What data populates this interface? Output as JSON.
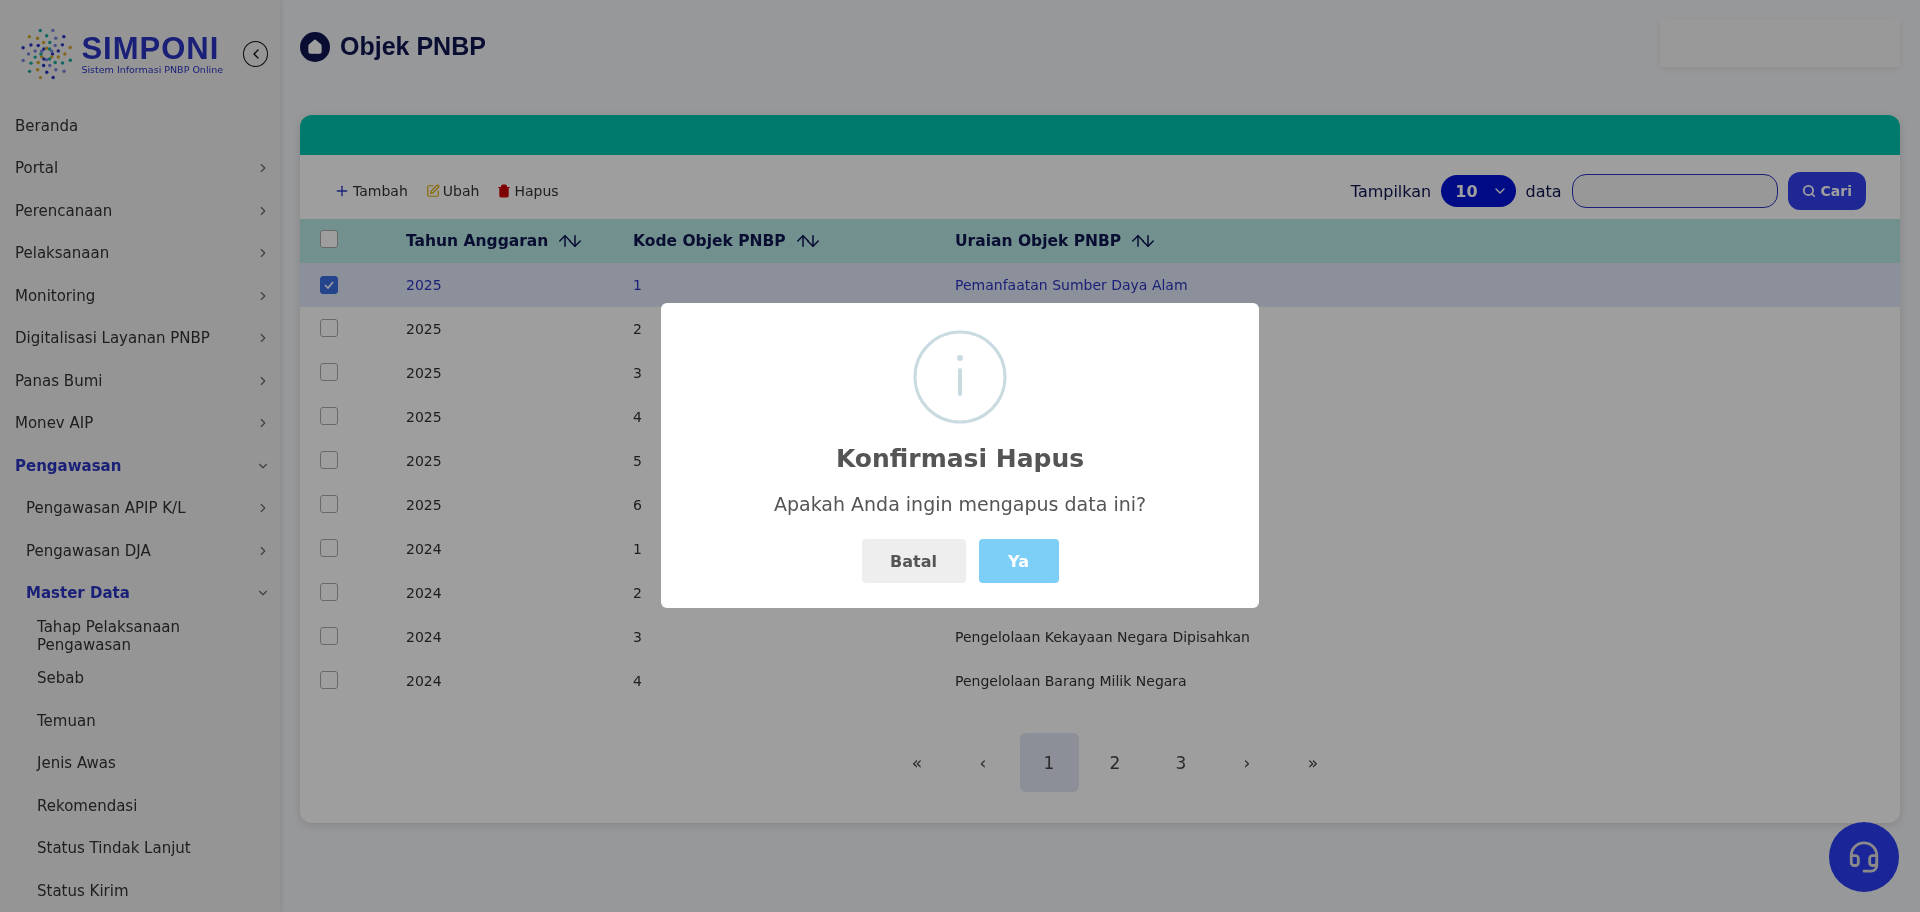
{
  "brand": {
    "name": "SIMPONI",
    "tagline": "Sistem Informasi PNBP Online"
  },
  "sidebar": {
    "items": [
      {
        "label": "Beranda",
        "active": false
      },
      {
        "label": "Portal",
        "active": false,
        "expanded": false
      },
      {
        "label": "Perencanaan",
        "active": false,
        "expanded": false
      },
      {
        "label": "Pelaksanaan",
        "active": false,
        "expanded": false
      },
      {
        "label": "Monitoring",
        "active": false,
        "expanded": false
      },
      {
        "label": "Digitalisasi Layanan PNBP",
        "active": false,
        "expanded": false
      },
      {
        "label": "Panas Bumi",
        "active": false,
        "expanded": false
      },
      {
        "label": "Monev AIP",
        "active": false,
        "expanded": false
      },
      {
        "label": "Pengawasan",
        "active": true,
        "expanded": true,
        "children": [
          {
            "label": "Pengawasan APIP K/L",
            "active": false,
            "expanded": false
          },
          {
            "label": "Pengawasan DJA",
            "active": false,
            "expanded": false
          },
          {
            "label": "Master Data",
            "active": true,
            "expanded": true,
            "children": [
              {
                "label": "Tahap Pelaksanaan Pengawasan",
                "active": false
              },
              {
                "label": "Sebab",
                "active": false
              },
              {
                "label": "Temuan",
                "active": false
              },
              {
                "label": "Jenis Awas",
                "active": false
              },
              {
                "label": "Rekomendasi",
                "active": false
              },
              {
                "label": "Status Tindak Lanjut",
                "active": false
              },
              {
                "label": "Status Kirim",
                "active": false
              }
            ]
          }
        ]
      }
    ]
  },
  "page_title": "Objek PNBP",
  "toolbar": {
    "actions": [
      {
        "kind": "add",
        "label": "Tambah"
      },
      {
        "kind": "edit",
        "label": "Ubah"
      },
      {
        "kind": "delete",
        "label": "Hapus"
      }
    ],
    "show_label": "Tampilkan",
    "page_size": "10",
    "data_label": "data",
    "search_button": "Cari"
  },
  "table": {
    "select_all": {
      "checked": false
    },
    "columns": [
      "Tahun Anggaran",
      "Kode Objek PNBP",
      "Uraian Objek PNBP"
    ],
    "rows": [
      {
        "checked": true,
        "selected": true,
        "cells": [
          "2025",
          "1",
          "Pemanfaatan Sumber Daya Alam"
        ]
      },
      {
        "checked": false,
        "selected": false,
        "cells": [
          "2025",
          "2"
        ]
      },
      {
        "checked": false,
        "selected": false,
        "cells": [
          "2025",
          "3"
        ]
      },
      {
        "checked": false,
        "selected": false,
        "cells": [
          "2025",
          "4"
        ]
      },
      {
        "checked": false,
        "selected": false,
        "cells": [
          "2025",
          "5"
        ]
      },
      {
        "checked": false,
        "selected": false,
        "cells": [
          "2025",
          "6"
        ]
      },
      {
        "checked": false,
        "selected": false,
        "cells": [
          "2024",
          "1"
        ]
      },
      {
        "checked": false,
        "selected": false,
        "cells": [
          "2024",
          "2"
        ]
      },
      {
        "checked": false,
        "selected": false,
        "cells": [
          "2024",
          "3",
          "Pengelolaan Kekayaan Negara Dipisahkan"
        ]
      },
      {
        "checked": false,
        "selected": false,
        "cells": [
          "2024",
          "4",
          "Pengelolaan Barang Milik Negara"
        ]
      }
    ]
  },
  "pagination": [
    {
      "label": "«",
      "selected": false
    },
    {
      "label": "‹",
      "selected": false
    },
    {
      "label": "1",
      "selected": true
    },
    {
      "label": "2",
      "selected": false
    },
    {
      "label": "3",
      "selected": false
    },
    {
      "label": "›",
      "selected": false
    },
    {
      "label": "»",
      "selected": false
    }
  ],
  "dialog": {
    "title": "Konfirmasi Hapus",
    "message": "Apakah Anda ingin mengapus data ini?",
    "buttons": [
      {
        "kind": "cancel",
        "label": "Batal"
      },
      {
        "kind": "confirm",
        "label": "Ya"
      }
    ]
  }
}
